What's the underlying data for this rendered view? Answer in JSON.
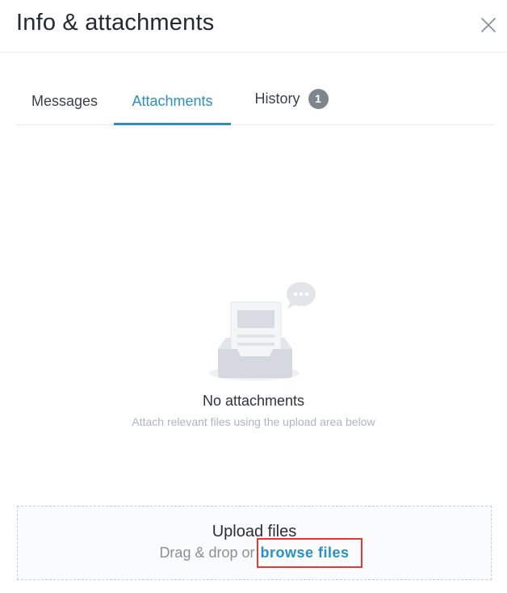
{
  "header": {
    "title": "Info & attachments",
    "close_icon": "close-icon"
  },
  "tabs": [
    {
      "label": "Messages",
      "active": false
    },
    {
      "label": "Attachments",
      "active": true
    },
    {
      "label": "History",
      "active": false,
      "badge": "1"
    }
  ],
  "empty_state": {
    "icon": "inbox-document-chat-illustration",
    "title": "No attachments",
    "subtitle": "Attach relevant files using the upload area below"
  },
  "upload": {
    "title": "Upload files",
    "prefix": "Drag & drop or",
    "link_label": "browse files"
  },
  "colors": {
    "accent": "#2a8fc9",
    "badge": "#7e858d",
    "highlight": "#e53935"
  }
}
